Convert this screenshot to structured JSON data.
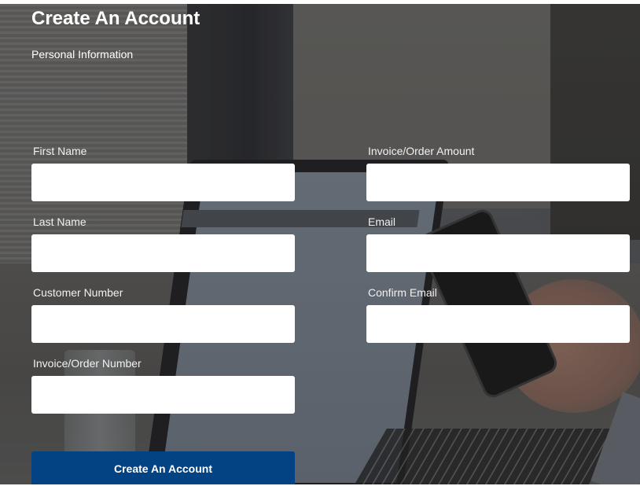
{
  "page": {
    "title": "Create An Account",
    "section": "Personal Information"
  },
  "form": {
    "left_column": [
      {
        "label": "First Name",
        "value": "",
        "placeholder": ""
      },
      {
        "label": "Last Name",
        "value": "",
        "placeholder": ""
      },
      {
        "label": "Customer Number",
        "value": "",
        "placeholder": ""
      },
      {
        "label": "Invoice/Order Number",
        "value": "",
        "placeholder": ""
      }
    ],
    "right_column": [
      {
        "label": "Invoice/Order Amount",
        "value": "",
        "placeholder": ""
      },
      {
        "label": "Email",
        "value": "",
        "placeholder": ""
      },
      {
        "label": "Confirm Email",
        "value": "",
        "placeholder": ""
      }
    ],
    "submit_label": "Create An Account"
  },
  "colors": {
    "button_bg": "#034383",
    "text_on_dark": "#ffffff",
    "input_bg": "#ffffff"
  }
}
